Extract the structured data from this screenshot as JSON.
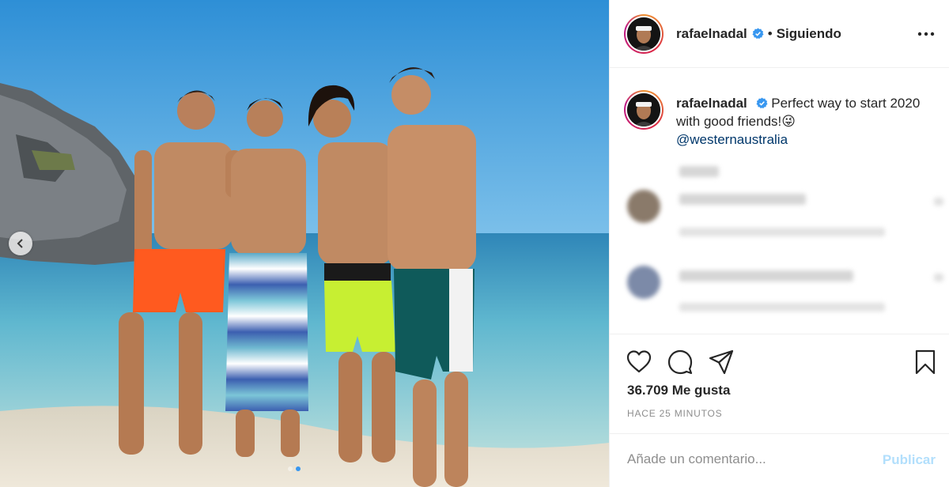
{
  "post": {
    "username": "rafaelnadal",
    "follow_status": "Siguiendo",
    "bullet": "•",
    "caption_text": "Perfect way to start 2020 with good friends!😜",
    "caption_mention": "@westernaustralia",
    "likes": "36.709 Me gusta",
    "time_ago": "HACE 25 MINUTOS",
    "comment_placeholder": "Añade un comentario...",
    "publish_label": "Publicar",
    "carousel": {
      "total": 2,
      "active": 1
    }
  },
  "icons": {
    "verified": "verified-badge-icon",
    "more": "more-options-icon",
    "like": "heart-icon",
    "comment": "comment-icon",
    "share": "share-icon",
    "save": "bookmark-icon",
    "prev": "chevron-left-icon"
  },
  "colors": {
    "verified_blue": "#3897f0",
    "text": "#262626",
    "secondary": "#8e8e8e",
    "publish_disabled": "#b2dffc",
    "mention": "#00376b"
  }
}
